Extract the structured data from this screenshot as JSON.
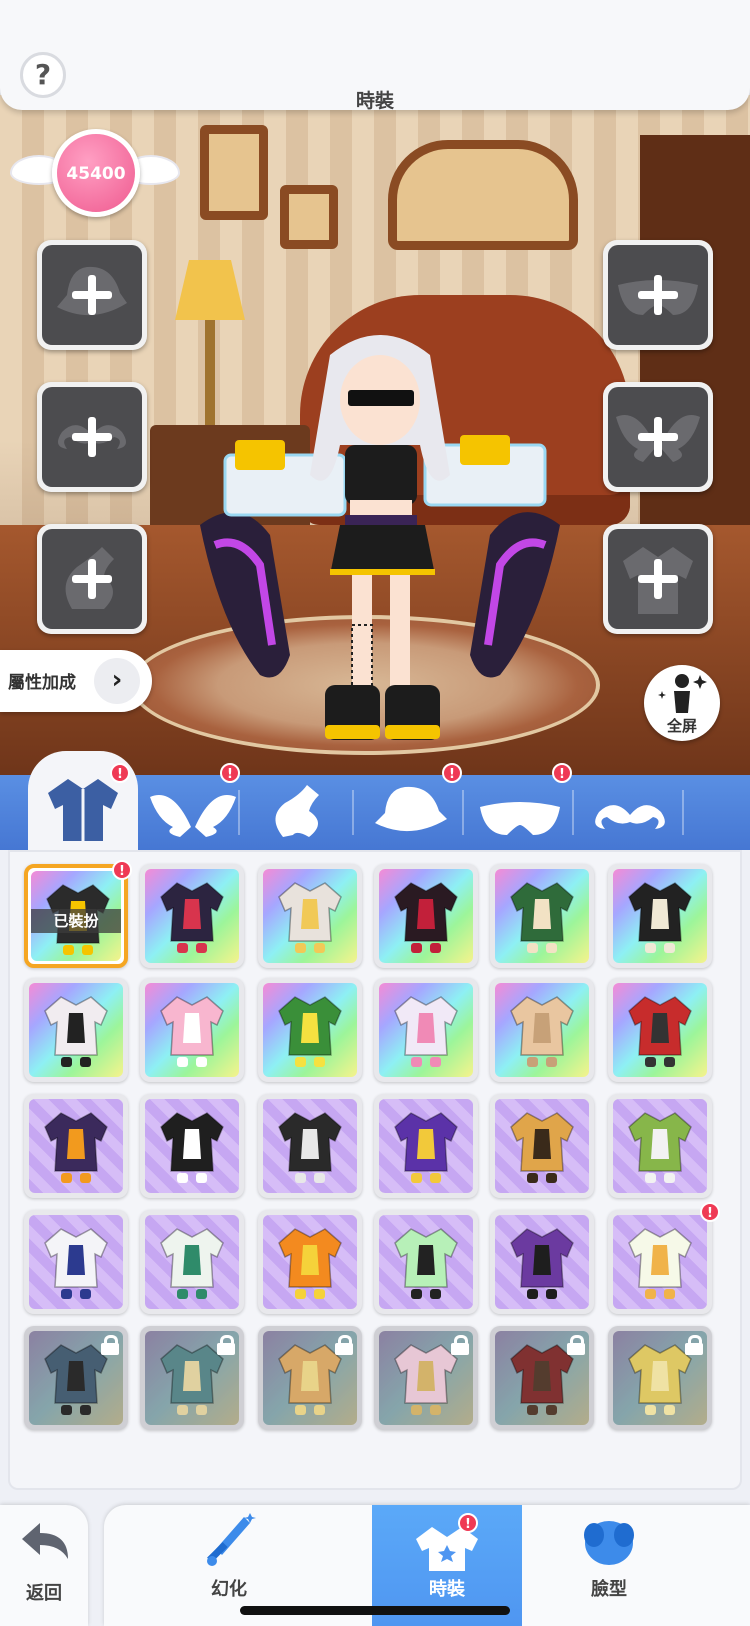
{
  "header": {
    "title": "時裝",
    "help_icon": "?"
  },
  "currency": {
    "value": "45400",
    "icon": "winged-coin-icon"
  },
  "slots_left": [
    {
      "name": "hat-slot",
      "icon": "hat-icon"
    },
    {
      "name": "mustache-slot",
      "icon": "mustache-icon"
    },
    {
      "name": "tail-slot",
      "icon": "tail-icon"
    }
  ],
  "slots_right": [
    {
      "name": "mask-slot",
      "icon": "mask-icon"
    },
    {
      "name": "wings-slot",
      "icon": "wings-icon"
    },
    {
      "name": "outfit-slot",
      "icon": "outfit-icon"
    }
  ],
  "attribute_button": {
    "label": "屬性加成"
  },
  "fullscreen_button": {
    "label": "全屏"
  },
  "category_tabs": [
    {
      "icon": "outfit-icon",
      "active": true,
      "notification": true
    },
    {
      "icon": "wings-icon",
      "active": false,
      "notification": true
    },
    {
      "icon": "tail-icon",
      "active": false,
      "notification": false
    },
    {
      "icon": "hat-icon",
      "active": false,
      "notification": true
    },
    {
      "icon": "mask-icon",
      "active": false,
      "notification": true
    },
    {
      "icon": "mustache-icon",
      "active": false,
      "notification": false
    }
  ],
  "grid": {
    "equipped_label": "已裝扮",
    "items": [
      {
        "bg": "rainbow",
        "color": "#2b2b2b",
        "accent": "#f5c400",
        "equipped": true,
        "notification": true
      },
      {
        "bg": "rainbow",
        "color": "#2c2440",
        "accent": "#d8344d"
      },
      {
        "bg": "rainbow",
        "color": "#e8e2dc",
        "accent": "#f1c957"
      },
      {
        "bg": "rainbow",
        "color": "#2a1a22",
        "accent": "#c2203a"
      },
      {
        "bg": "rainbow",
        "color": "#2f6b3a",
        "accent": "#f2e2c4"
      },
      {
        "bg": "rainbow",
        "color": "#222222",
        "accent": "#f0e9d6"
      },
      {
        "bg": "rainbow",
        "color": "#f1ecf0",
        "accent": "#222222"
      },
      {
        "bg": "rainbow",
        "color": "#f8b6cf",
        "accent": "#ffffff"
      },
      {
        "bg": "rainbow",
        "color": "#3a8f39",
        "accent": "#f5e140"
      },
      {
        "bg": "rainbow",
        "color": "#f1e9f7",
        "accent": "#f08ab6"
      },
      {
        "bg": "rainbow",
        "color": "#e9c6a0",
        "accent": "#c7a178"
      },
      {
        "bg": "rainbow",
        "color": "#c72c2c",
        "accent": "#333333"
      },
      {
        "bg": "purple",
        "color": "#3b2a5c",
        "accent": "#f29a1e"
      },
      {
        "bg": "purple",
        "color": "#1f1f1f",
        "accent": "#ffffff"
      },
      {
        "bg": "purple",
        "color": "#2a2a2a",
        "accent": "#e8e8e8"
      },
      {
        "bg": "purple",
        "color": "#5b32a8",
        "accent": "#f2c93a"
      },
      {
        "bg": "purple",
        "color": "#e0a54a",
        "accent": "#3a2a1a"
      },
      {
        "bg": "purple",
        "color": "#87b64a",
        "accent": "#f2f2f2"
      },
      {
        "bg": "purple",
        "color": "#f4f4f8",
        "accent": "#2c3a8f"
      },
      {
        "bg": "purple",
        "color": "#eef4ee",
        "accent": "#2f8b6a"
      },
      {
        "bg": "purple",
        "color": "#f38a1f",
        "accent": "#f5d23a"
      },
      {
        "bg": "purple",
        "color": "#b7f0b8",
        "accent": "#222222"
      },
      {
        "bg": "purple",
        "color": "#6b3aa0",
        "accent": "#1e1e1e"
      },
      {
        "bg": "purple",
        "color": "#f6f9e8",
        "accent": "#f0b34a",
        "notification": true
      },
      {
        "bg": "locked",
        "color": "#3e5f7c",
        "accent": "#2a2a2a",
        "locked": true
      },
      {
        "bg": "locked",
        "color": "#4a8a8e",
        "accent": "#e7d18b",
        "locked": true
      },
      {
        "bg": "locked",
        "color": "#e9a64a",
        "accent": "#f1d36a",
        "locked": true
      },
      {
        "bg": "locked",
        "color": "#f1c4d8",
        "accent": "#e0b24a",
        "locked": true
      },
      {
        "bg": "locked",
        "color": "#9b2a2a",
        "accent": "#5c3a26",
        "locked": true
      },
      {
        "bg": "locked",
        "color": "#e8c93a",
        "accent": "#f5e38a",
        "locked": true
      }
    ]
  },
  "bottom_nav": {
    "back": {
      "label": "返回",
      "icon": "back-arrow-icon"
    },
    "items": [
      {
        "label": "幻化",
        "icon": "sword-icon",
        "active": false
      },
      {
        "label": "時裝",
        "icon": "outfit-icon",
        "active": true,
        "notification": true
      },
      {
        "label": "臉型",
        "icon": "face-icon",
        "active": false
      }
    ]
  },
  "colors": {
    "accent": "#4f96f1",
    "tab_bar": "#5a8fe3",
    "notification": "#ef3a55",
    "equipped_border": "#f5a623"
  }
}
